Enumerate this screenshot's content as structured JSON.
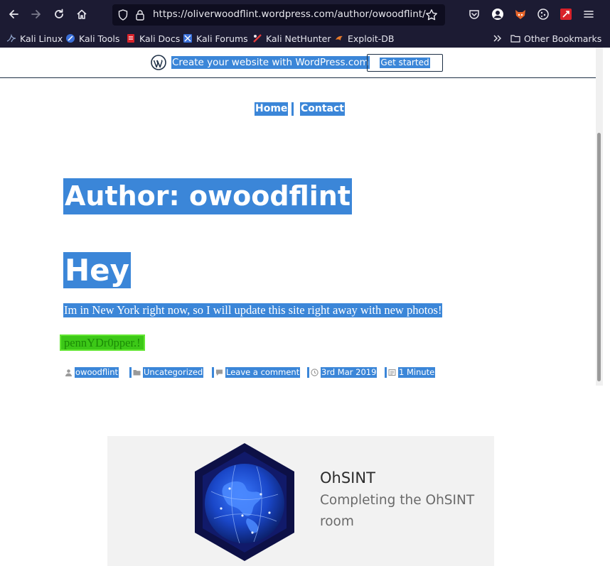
{
  "browser": {
    "url": "https://oliverwoodflint.wordpress.com/author/owoodflint/",
    "bookmarks": [
      "Kali Linux",
      "Kali Tools",
      "Kali Docs",
      "Kali Forums",
      "Kali NetHunter",
      "Exploit-DB"
    ],
    "other_bookmarks": "Other Bookmarks"
  },
  "wp_banner": {
    "text": "Create your website with WordPress.com",
    "button": "Get started"
  },
  "site_nav": {
    "items": [
      "Home",
      "Contact"
    ]
  },
  "archive": {
    "title": "Author: owoodflint"
  },
  "post": {
    "title": "Hey",
    "body": "Im in New York right now, so I will update this site right away with new photos!",
    "hidden_text": "pennYDr0pper.!",
    "meta": {
      "author": "owoodflint",
      "category": "Uncategorized",
      "comment": "Leave a comment",
      "date": "3rd Mar 2019",
      "read_time": "1 Minute"
    }
  },
  "card": {
    "title": "OhSINT",
    "description": "Completing the OhSINT room"
  },
  "colors": {
    "chrome_bg": "#1c1b33",
    "selection": "#3b86d8",
    "highlight_green": "#3cc817"
  }
}
